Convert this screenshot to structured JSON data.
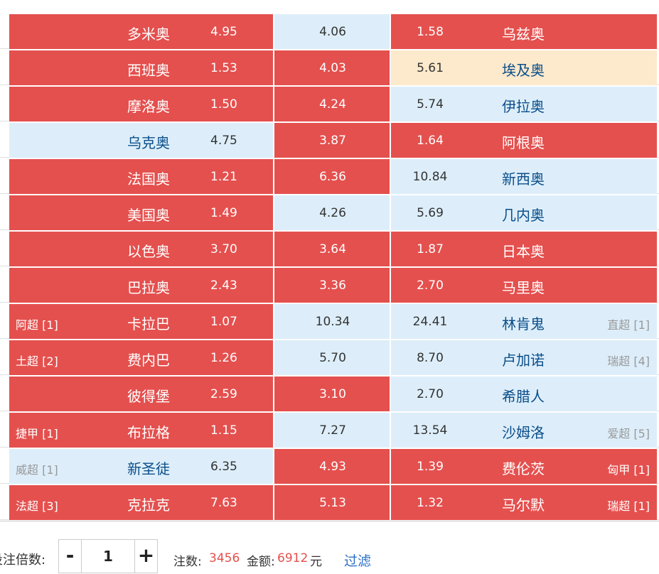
{
  "rows": [
    {
      "lleague": "",
      "home": "多米奥",
      "home_odd": "4.95",
      "draw": "4.06",
      "away_odd": "1.58",
      "away": "乌兹奥",
      "rleague": ""
    },
    {
      "lleague": "",
      "home": "西班奥",
      "home_odd": "1.53",
      "draw": "4.03",
      "away_odd": "5.61",
      "away": "埃及奥",
      "rleague": ""
    },
    {
      "lleague": "",
      "home": "摩洛奥",
      "home_odd": "1.50",
      "draw": "4.24",
      "away_odd": "5.74",
      "away": "伊拉奥",
      "rleague": ""
    },
    {
      "lleague": "",
      "home": "乌克奥",
      "home_odd": "4.75",
      "draw": "3.87",
      "away_odd": "1.64",
      "away": "阿根奥",
      "rleague": ""
    },
    {
      "lleague": "",
      "home": "法国奥",
      "home_odd": "1.21",
      "draw": "6.36",
      "away_odd": "10.84",
      "away": "新西奥",
      "rleague": ""
    },
    {
      "lleague": "",
      "home": "美国奥",
      "home_odd": "1.49",
      "draw": "4.26",
      "away_odd": "5.69",
      "away": "几内奥",
      "rleague": ""
    },
    {
      "lleague": "",
      "home": "以色奥",
      "home_odd": "3.70",
      "draw": "3.64",
      "away_odd": "1.87",
      "away": "日本奥",
      "rleague": ""
    },
    {
      "lleague": "",
      "home": "巴拉奥",
      "home_odd": "2.43",
      "draw": "3.36",
      "away_odd": "2.70",
      "away": "马里奥",
      "rleague": ""
    },
    {
      "lleague": "阿超 [1]",
      "home": "卡拉巴",
      "home_odd": "1.07",
      "draw": "10.34",
      "away_odd": "24.41",
      "away": "林肯鬼",
      "rleague": "直超 [1]"
    },
    {
      "lleague": "土超 [2]",
      "home": "费内巴",
      "home_odd": "1.26",
      "draw": "5.70",
      "away_odd": "8.70",
      "away": "卢加诺",
      "rleague": "瑞超 [4]"
    },
    {
      "lleague": "",
      "home": "彼得堡",
      "home_odd": "2.59",
      "draw": "3.10",
      "away_odd": "2.70",
      "away": "希腊人",
      "rleague": ""
    },
    {
      "lleague": "捷甲 [1]",
      "home": "布拉格",
      "home_odd": "1.15",
      "draw": "7.27",
      "away_odd": "13.54",
      "away": "沙姆洛",
      "rleague": "爱超 [5]"
    },
    {
      "lleague": "威超 [1]",
      "home": "新圣徒",
      "home_odd": "6.35",
      "draw": "4.93",
      "away_odd": "1.39",
      "away": "费伦茨",
      "rleague": "匈甲 [1]"
    },
    {
      "lleague": "法超 [3]",
      "home": "克拉克",
      "home_odd": "7.63",
      "draw": "5.13",
      "away_odd": "1.32",
      "away": "马尔默",
      "rleague": "瑞超 [1]"
    }
  ],
  "selection_states": [
    [
      "red",
      "blue",
      "red"
    ],
    [
      "red",
      "red",
      "cream"
    ],
    [
      "red",
      "red",
      "blue"
    ],
    [
      "blue",
      "red",
      "red"
    ],
    [
      "red",
      "red",
      "blue"
    ],
    [
      "red",
      "blue",
      "blue"
    ],
    [
      "red",
      "red",
      "red"
    ],
    [
      "red",
      "red",
      "red"
    ],
    [
      "red",
      "blue",
      "blue"
    ],
    [
      "red",
      "blue",
      "blue"
    ],
    [
      "red",
      "red",
      "blue"
    ],
    [
      "red",
      "blue",
      "blue"
    ],
    [
      "blue",
      "red",
      "red"
    ],
    [
      "red",
      "red",
      "red"
    ]
  ],
  "colors": {
    "selected": "#e4504e",
    "unselected": "#ddeefa",
    "highlight": "#fde9cb",
    "accent_text": "#e4504e",
    "link": "#2a6fc7"
  },
  "bottom": {
    "multiplier_label": "投注倍数:",
    "minus": "-",
    "multiplier_value": "1",
    "plus": "+",
    "count_label": "注数:",
    "count_value": "3456",
    "amount_label": "金额:",
    "amount_value": "6912",
    "amount_unit": "元",
    "filter": "过滤"
  }
}
